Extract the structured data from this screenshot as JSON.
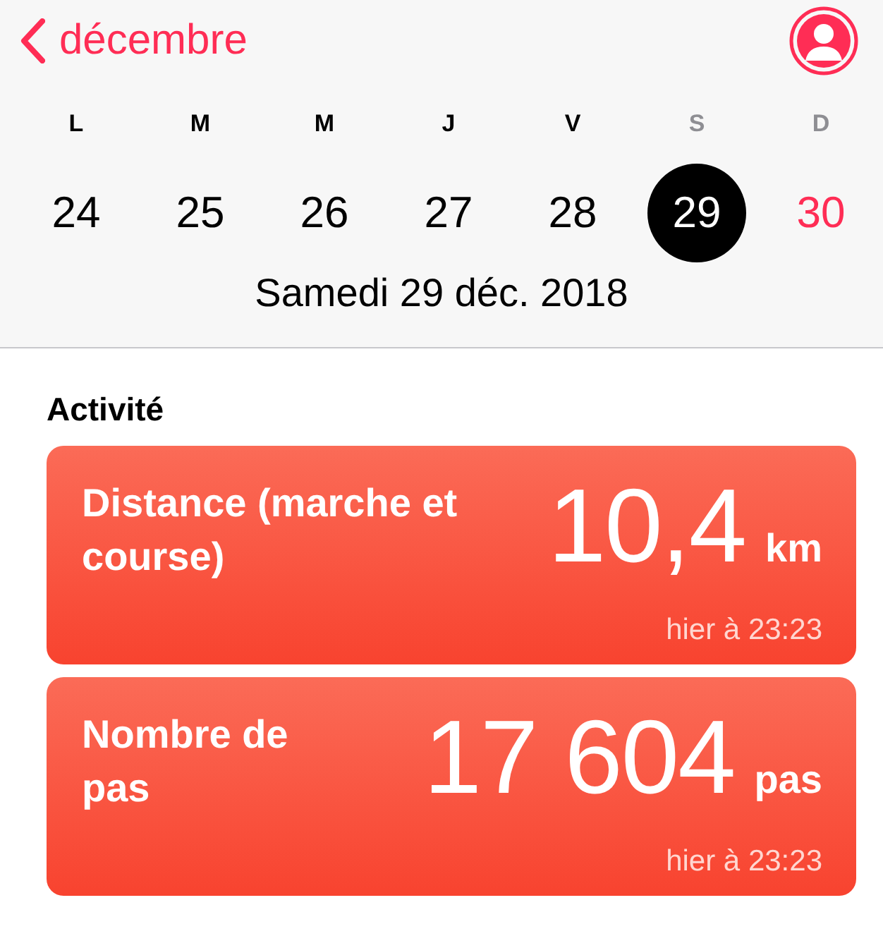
{
  "header": {
    "back_label": "décembre"
  },
  "week": {
    "days": [
      {
        "letter": "L",
        "date": "24",
        "kind": "weekday",
        "selected": false
      },
      {
        "letter": "M",
        "date": "25",
        "kind": "weekday",
        "selected": false
      },
      {
        "letter": "M",
        "date": "26",
        "kind": "weekday",
        "selected": false
      },
      {
        "letter": "J",
        "date": "27",
        "kind": "weekday",
        "selected": false
      },
      {
        "letter": "V",
        "date": "28",
        "kind": "weekday",
        "selected": false
      },
      {
        "letter": "S",
        "date": "29",
        "kind": "saturday",
        "selected": true
      },
      {
        "letter": "D",
        "date": "30",
        "kind": "sunday",
        "selected": false
      }
    ],
    "date_title": "Samedi 29 déc. 2018"
  },
  "section_title": "Activité",
  "cards": [
    {
      "title": "Distance (marche et course)",
      "value": "10,4",
      "unit": "km",
      "time": "hier à 23:23"
    },
    {
      "title": "Nombre de pas",
      "value": "17 604",
      "unit": "pas",
      "time": "hier à 23:23"
    }
  ]
}
